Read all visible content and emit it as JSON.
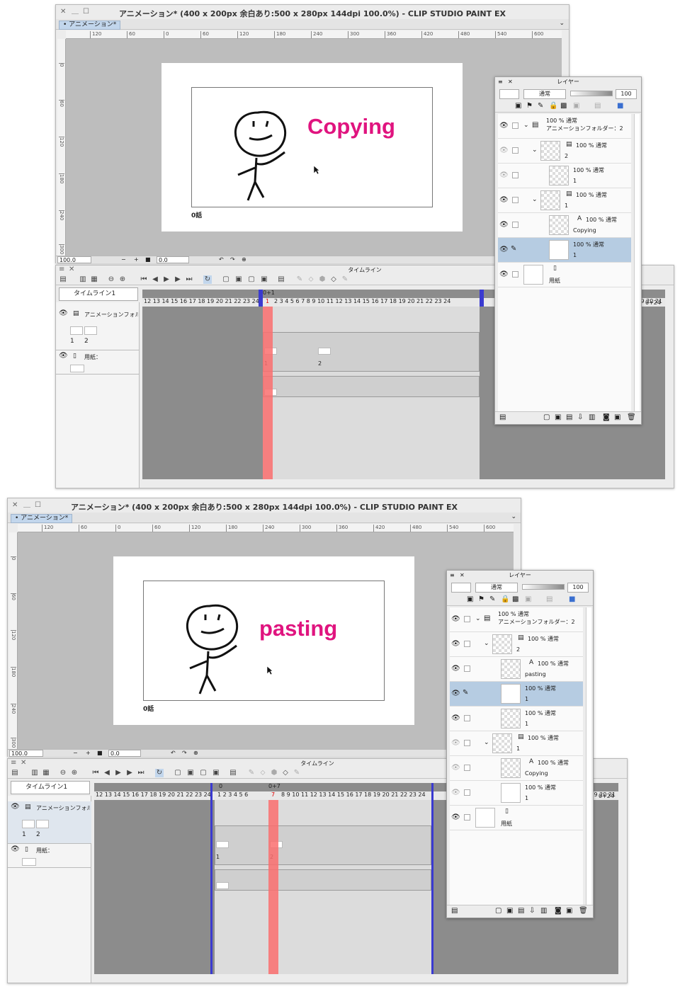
{
  "shots": [
    {
      "title": "アニメーション* (400 x 200px 余白あり:500 x 280px 144dpi 100.0%)  - CLIP STUDIO PAINT EX",
      "tab": "• アニメーション*",
      "ruler": [
        "120",
        "60",
        "0",
        "60",
        "120",
        "180",
        "240",
        "300",
        "360",
        "420",
        "480",
        "540",
        "600"
      ],
      "vruler": [
        "0",
        "60",
        "120",
        "180",
        "240",
        "300"
      ],
      "art_text": "Copying",
      "episode": "0話",
      "status": {
        "zoom": "100.0",
        "rotation": "0.0"
      },
      "timeline": {
        "title": "タイムライン",
        "select": "タイムライン1",
        "frames_left": [
          "12",
          "13",
          "14",
          "15",
          "16",
          "17",
          "18",
          "19",
          "20",
          "21",
          "22",
          "23",
          "24"
        ],
        "frames_main": [
          "1",
          "2",
          "3",
          "4",
          "5",
          "6",
          "7",
          "8",
          "9",
          "10",
          "11",
          "12",
          "13",
          "14",
          "15",
          "16",
          "17",
          "18",
          "19",
          "20",
          "21",
          "22",
          "23",
          "24"
        ],
        "frames_right": [
          "19",
          "20",
          "21"
        ],
        "playhead_label": "0+1",
        "end_label": "0+24",
        "tracks": [
          {
            "name": "アニメーションフォル",
            "cells": [
              "1",
              "2"
            ]
          },
          {
            "name": "用紙："
          }
        ],
        "kf": [
          "1",
          "2"
        ]
      },
      "layers": {
        "title": "レイヤー",
        "blend": "通常",
        "opacity": "100",
        "items": [
          {
            "l1": "100 % 通常",
            "l2": "アニメーションフォルダー：2"
          },
          {
            "l1": "100 % 通常",
            "l2": "2"
          },
          {
            "l1": "100 % 通常",
            "l2": "1"
          },
          {
            "l1": "100 % 通常",
            "l2": "1"
          },
          {
            "l1": "100 % 通常",
            "l2": "Copying"
          },
          {
            "l1": "100 % 通常",
            "l2": "1"
          },
          {
            "l1": "",
            "l2": "用紙"
          }
        ]
      }
    },
    {
      "title": "アニメーション* (400 x 200px 余白あり:500 x 280px 144dpi 100.0%)  - CLIP STUDIO PAINT EX",
      "tab": "• アニメーション*",
      "ruler": [
        "120",
        "60",
        "0",
        "60",
        "120",
        "180",
        "240",
        "300",
        "360",
        "420",
        "480",
        "540",
        "600"
      ],
      "vruler": [
        "0",
        "60",
        "120",
        "180",
        "240",
        "300"
      ],
      "art_text": "pasting",
      "episode": "0話",
      "status": {
        "zoom": "100.0",
        "rotation": "0.0"
      },
      "timeline": {
        "title": "タイムライン",
        "select": "タイムライン1",
        "frames_left": [
          "12",
          "13",
          "14",
          "15",
          "16",
          "17",
          "18",
          "19",
          "20",
          "21",
          "22",
          "23",
          "24"
        ],
        "frames_main": [
          "1",
          "2",
          "3",
          "4",
          "5",
          "6",
          "7",
          "8",
          "9",
          "10",
          "11",
          "12",
          "13",
          "14",
          "15",
          "16",
          "17",
          "18",
          "19",
          "20",
          "21",
          "22",
          "23",
          "24"
        ],
        "frames_right": [
          "19",
          "20",
          "21"
        ],
        "playhead_label": "0+7",
        "start_label": "0",
        "end_label": "0+24",
        "tracks": [
          {
            "name": "アニメーションフォル",
            "cells": [
              "1",
              "2"
            ]
          },
          {
            "name": "用紙："
          }
        ],
        "kf": [
          "1",
          "2"
        ]
      },
      "layers": {
        "title": "レイヤー",
        "blend": "通常",
        "opacity": "100",
        "items": [
          {
            "l1": "100 % 通常",
            "l2": "アニメーションフォルダー：2"
          },
          {
            "l1": "100 % 通常",
            "l2": "2"
          },
          {
            "l1": "100 % 通常",
            "l2": "pasting"
          },
          {
            "l1": "100 % 通常",
            "l2": "1"
          },
          {
            "l1": "100 % 通常",
            "l2": "1"
          },
          {
            "l1": "100 % 通常",
            "l2": "1"
          },
          {
            "l1": "100 % 通常",
            "l2": "Copying"
          },
          {
            "l1": "100 % 通常",
            "l2": "1"
          },
          {
            "l1": "",
            "l2": "用紙"
          }
        ]
      }
    }
  ],
  "colors": {
    "accent_text": "#e0147f",
    "playhead": "#f86e6e",
    "selection": "#b6cce2",
    "range_marker": "#3a3ad0"
  }
}
